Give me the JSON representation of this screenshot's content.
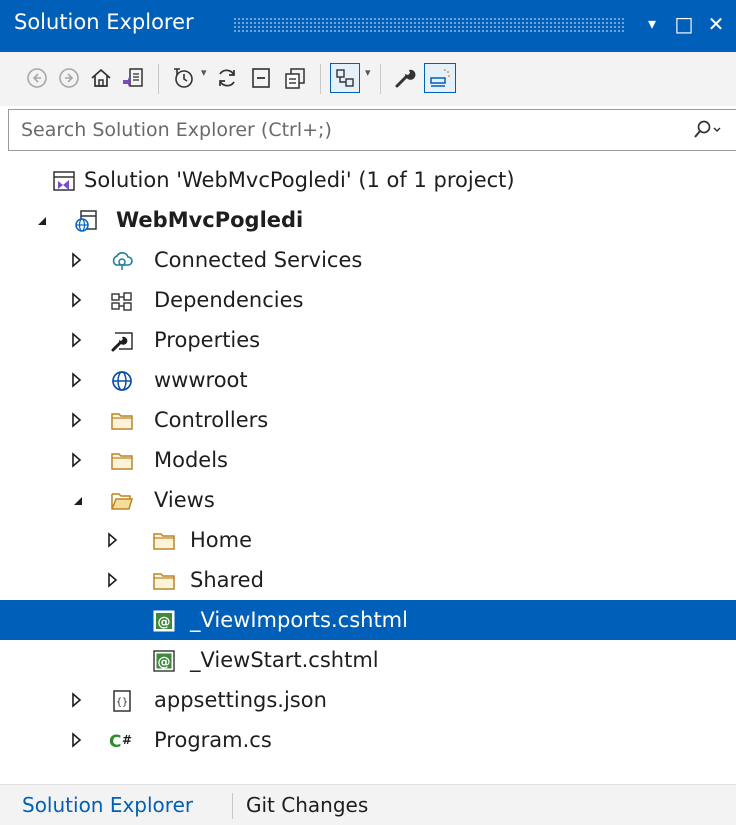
{
  "window": {
    "title": "Solution Explorer",
    "buttons": {
      "dropdown": "▾",
      "maximize": "□",
      "close": "✕"
    }
  },
  "toolbar": {
    "icons": [
      "back-icon",
      "forward-icon",
      "home-icon",
      "switch-views-icon",
      "pending-changes-filter-icon",
      "sync-icon",
      "collapse-all-icon",
      "show-all-files-icon",
      "preview-selected-icon",
      "properties-icon",
      "git-icon"
    ]
  },
  "search": {
    "placeholder": "Search Solution Explorer (Ctrl+;)",
    "icon": "search-icon"
  },
  "tree": {
    "solution": "Solution 'WebMvcPogledi' (1 of 1 project)",
    "project": "WebMvcPogledi",
    "items": {
      "connected_services": "Connected Services",
      "dependencies": "Dependencies",
      "properties": "Properties",
      "wwwroot": "wwwroot",
      "controllers": "Controllers",
      "models": "Models",
      "views": "Views",
      "home": "Home",
      "shared": "Shared",
      "view_imports": "_ViewImports.cshtml",
      "view_start": "_ViewStart.cshtml",
      "appsettings": "appsettings.json",
      "program": "Program.cs"
    },
    "selected": "_ViewImports.cshtml"
  },
  "tabs": {
    "solution_explorer": "Solution Explorer",
    "git_changes": "Git Changes"
  },
  "colors": {
    "accent": "#005fb8",
    "folder": "#d9a534",
    "razor_green": "#3c8a3c"
  }
}
